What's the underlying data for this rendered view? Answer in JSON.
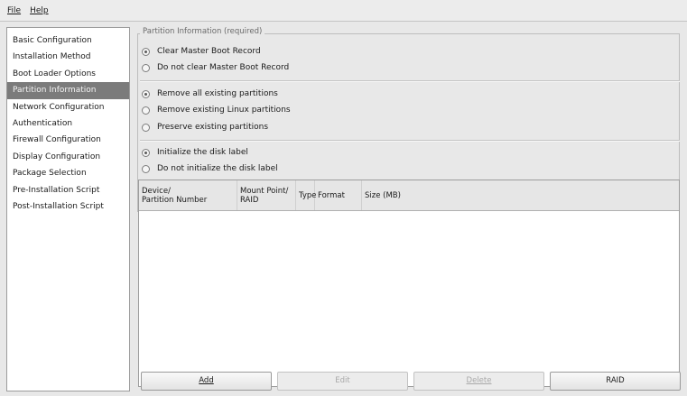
{
  "menu": [
    {
      "label": "File",
      "name": "menu-file"
    },
    {
      "label": "Help",
      "name": "menu-help"
    }
  ],
  "sidebar": {
    "selected_index": 3,
    "items": [
      {
        "label": "Basic Configuration"
      },
      {
        "label": "Installation Method"
      },
      {
        "label": "Boot Loader Options"
      },
      {
        "label": "Partition Information"
      },
      {
        "label": "Network Configuration"
      },
      {
        "label": "Authentication"
      },
      {
        "label": "Firewall Configuration"
      },
      {
        "label": "Display Configuration"
      },
      {
        "label": "Package Selection"
      },
      {
        "label": "Pre-Installation Script"
      },
      {
        "label": "Post-Installation Script"
      }
    ]
  },
  "partition": {
    "section_title": "Partition Information (required)",
    "mbr_options": [
      {
        "label": "Clear Master Boot Record",
        "selected": true
      },
      {
        "label": "Do not clear Master Boot Record",
        "selected": false
      }
    ],
    "partition_options": [
      {
        "label": "Remove all existing partitions",
        "selected": true
      },
      {
        "label": "Remove existing Linux partitions",
        "selected": false
      },
      {
        "label": "Preserve existing partitions",
        "selected": false
      }
    ],
    "disklabel_options": [
      {
        "label": "Initialize the disk label",
        "selected": true
      },
      {
        "label": "Do not initialize the disk label",
        "selected": false
      }
    ]
  },
  "table": {
    "columns": [
      {
        "line1": "Device/",
        "line2": "Partition Number"
      },
      {
        "line1": "Mount Point/",
        "line2": "RAID"
      },
      {
        "line1": "Type",
        "line2": ""
      },
      {
        "line1": "Format",
        "line2": ""
      },
      {
        "line1": "Size (MB)",
        "line2": ""
      }
    ],
    "rows": []
  },
  "buttons": [
    {
      "label": "Add",
      "enabled": true
    },
    {
      "label": "Edit",
      "enabled": false
    },
    {
      "label": "Delete",
      "enabled": false
    },
    {
      "label": "RAID",
      "enabled": true
    }
  ]
}
